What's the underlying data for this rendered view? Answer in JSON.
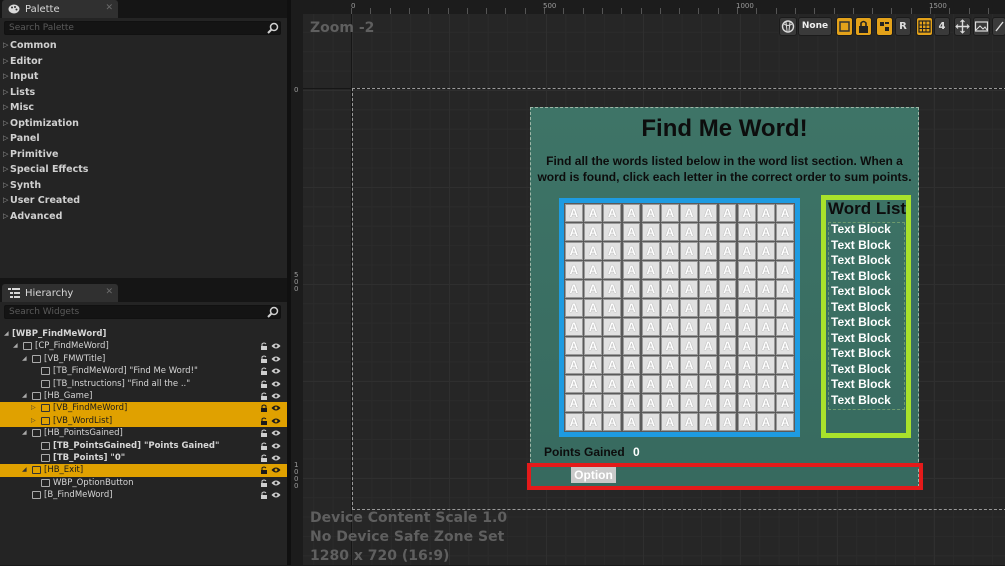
{
  "palette": {
    "tab_label": "Palette",
    "search_placeholder": "Search Palette",
    "categories": [
      "Common",
      "Editor",
      "Input",
      "Lists",
      "Misc",
      "Optimization",
      "Panel",
      "Primitive",
      "Special Effects",
      "Synth",
      "User Created",
      "Advanced"
    ]
  },
  "hierarchy": {
    "tab_label": "Hierarchy",
    "search_placeholder": "Search Widgets",
    "rows": [
      {
        "label": "[WBP_FindMeWord]",
        "bold": true
      },
      {
        "label": "[CP_FindMeWord]"
      },
      {
        "label": "[VB_FMWTitle]"
      },
      {
        "label": "[TB_FindMeWord] \"Find Me Word!\""
      },
      {
        "label": "[TB_Instructions] \"Find all the ..\""
      },
      {
        "label": "[HB_Game]"
      },
      {
        "label": "[VB_FindMeWord]"
      },
      {
        "label": "[VB_WordList]"
      },
      {
        "label": "[HB_PointsGained]"
      },
      {
        "label": "[TB_PointsGained] \"Points Gained\"",
        "bold": true
      },
      {
        "label": "[TB_Points] \"0\"",
        "bold": true
      },
      {
        "label": "[HB_Exit]"
      },
      {
        "label": "WBP_OptionButton"
      },
      {
        "label": "[B_FindMeWord]"
      }
    ]
  },
  "designer": {
    "zoom_label": "Zoom -2",
    "ruler_top": [
      "0",
      "500",
      "1000",
      "1500"
    ],
    "ruler_left": [
      "0",
      "500",
      "1000"
    ],
    "toolbar_none": "None",
    "toolbar_r": "R",
    "toolbar_4": "4",
    "info_lines": [
      "Device Content Scale 1.0",
      "No Device Safe Zone Set",
      "1280 x 720 (16:9)"
    ]
  },
  "widget": {
    "title": "Find Me Word!",
    "instructions": "Find all the words listed below in the word list section. When a word is found, click each letter in the correct order to sum points.",
    "grid_letter": "A",
    "word_list_title": "Word List",
    "word_list_items": [
      "Text Block",
      "Text Block",
      "Text Block",
      "Text Block",
      "Text Block",
      "Text Block",
      "Text Block",
      "Text Block",
      "Text Block",
      "Text Block",
      "Text Block",
      "Text Block"
    ],
    "points_label": "Points Gained",
    "points_value": "0",
    "option_label": "Option"
  },
  "colors": {
    "accent": "#e0a100",
    "grid_border": "#1e9be1",
    "wordlist_border": "#a9e22b",
    "exit_border": "#e41a1a"
  }
}
